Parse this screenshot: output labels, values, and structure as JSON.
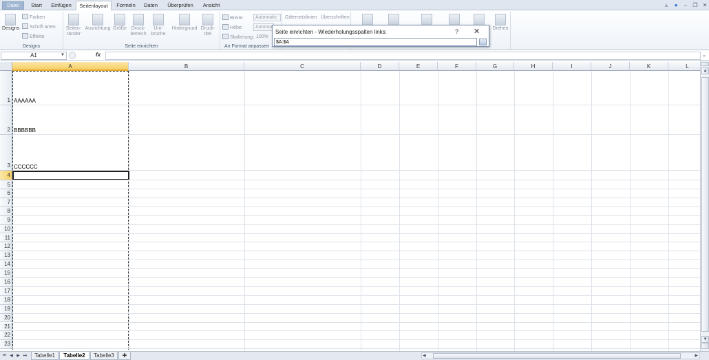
{
  "ribbon_tabs": [
    "Datei",
    "Start",
    "Einfügen",
    "Seitenlayout",
    "Formeln",
    "Daten",
    "Überprüfen",
    "Ansicht"
  ],
  "active_tab": "Seitenlayout",
  "ribbon": {
    "designs": {
      "label": "Designs",
      "big": "Designs",
      "farben": "Farben",
      "schriftarten": "Schrift arten",
      "effekte": "Effekte"
    },
    "seite_einrichten": {
      "label": "Seite einrichten",
      "seitenraender": "Seiten- ränder",
      "ausrichtung": "Ausrichtung",
      "groesse": "Größe",
      "druckbereich": "Druck- bereich",
      "umbrueche": "Um- brüche",
      "hintergrund": "Hintergrund",
      "drucktitel": "Druck- titel"
    },
    "an_format": {
      "label": "An Format anpassen",
      "breite": "Breite:",
      "hoehe": "Höhe:",
      "skalierung": "Skalierung:",
      "breite_val": "Automatic",
      "hoehe_val": "Automat",
      "skalierung_val": "100%"
    },
    "blatt": {
      "gitternetz": "Gitternetzlinien",
      "ueberschriften": "Überschriften"
    },
    "anordnen": {
      "drehen": "Drehen"
    }
  },
  "dialog": {
    "title": "Seite einrichten - Wiederholungsspalten links:",
    "help": "?",
    "close": "✕",
    "value": "$A:$A"
  },
  "formula_bar": {
    "name_box": "A1",
    "fx": "fx",
    "content": ""
  },
  "columns": [
    "A",
    "B",
    "C",
    "D",
    "E",
    "F",
    "G",
    "H",
    "I",
    "J",
    "K",
    "L"
  ],
  "rows": [
    "1",
    "2",
    "3",
    "4",
    "5",
    "6",
    "7",
    "8",
    "9",
    "10",
    "11",
    "12",
    "13",
    "14",
    "15",
    "16",
    "17",
    "18",
    "19",
    "20",
    "21",
    "22",
    "23"
  ],
  "cells": {
    "A1": "AAAAAA",
    "A2": "BBBBBB",
    "A3": "CCCCCC"
  },
  "sheets": [
    "Tabelle1",
    "Tabelle2",
    "Tabelle3"
  ],
  "active_sheet": "Tabelle2"
}
